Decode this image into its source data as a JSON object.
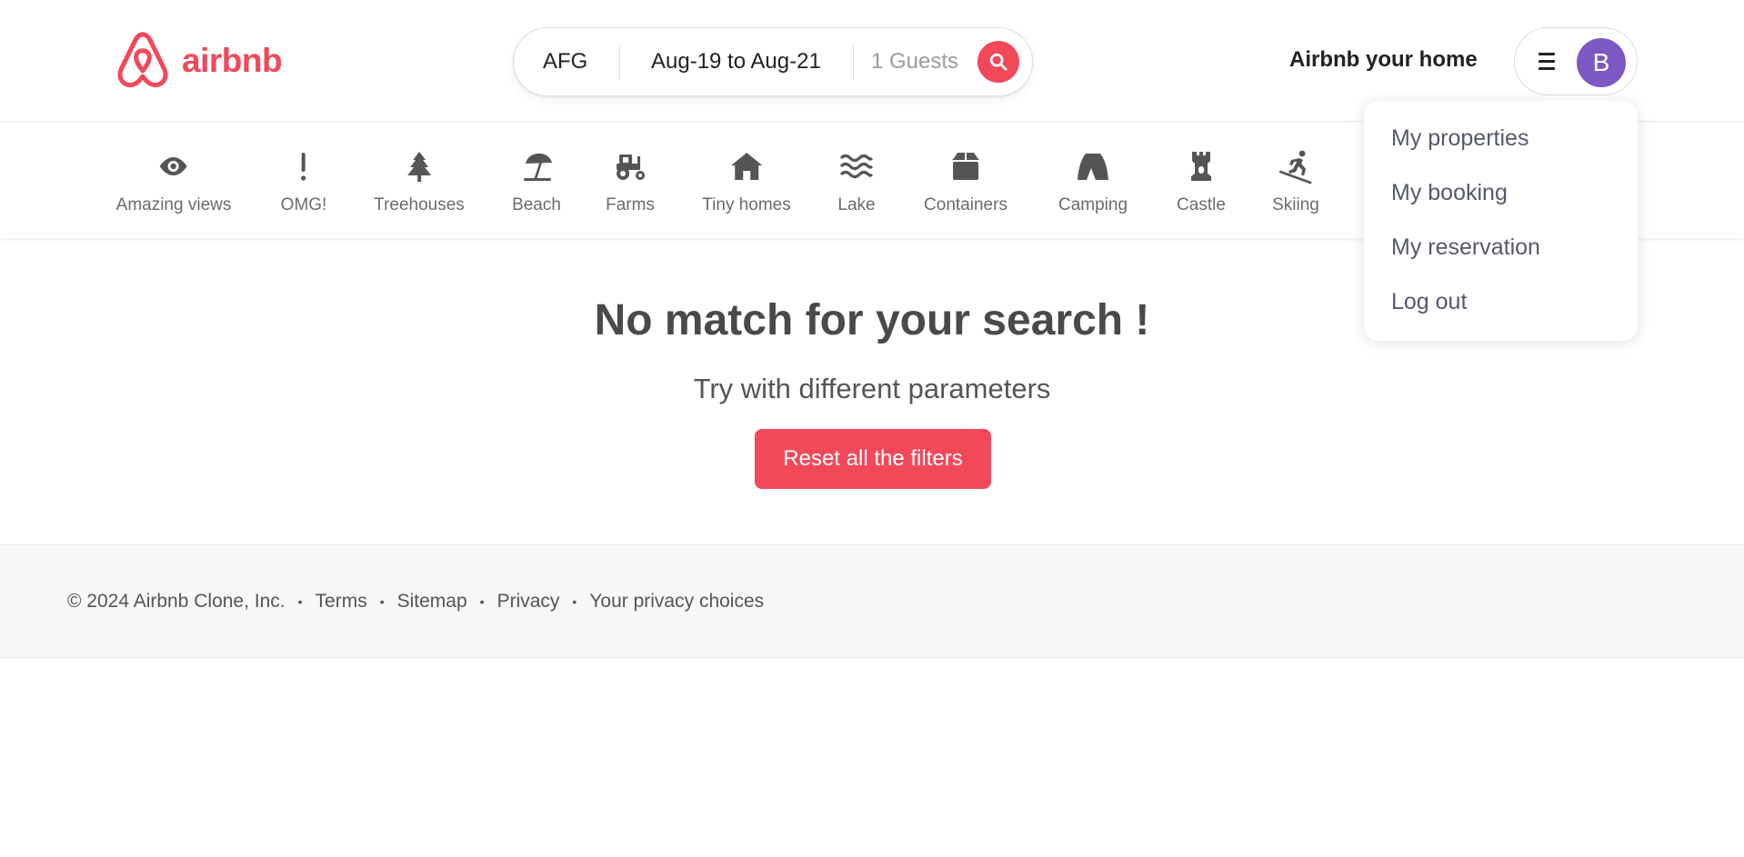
{
  "header": {
    "logo_text": "airbnb",
    "search": {
      "where": "AFG",
      "dates": "Aug-19 to Aug-21",
      "guests": "1 Guests"
    },
    "host_link": "Airbnb your home",
    "avatar_initial": "B"
  },
  "categories": [
    {
      "label": "Amazing views",
      "icon": "eye-icon"
    },
    {
      "label": "OMG!",
      "icon": "exclamation-icon"
    },
    {
      "label": "Treehouses",
      "icon": "tree-icon"
    },
    {
      "label": "Beach",
      "icon": "umbrella-beach-icon"
    },
    {
      "label": "Farms",
      "icon": "tractor-icon"
    },
    {
      "label": "Tiny homes",
      "icon": "house-icon"
    },
    {
      "label": "Lake",
      "icon": "water-icon"
    },
    {
      "label": "Containers",
      "icon": "box-icon"
    },
    {
      "label": "Camping",
      "icon": "tent-icon"
    },
    {
      "label": "Castle",
      "icon": "castle-icon"
    },
    {
      "label": "Skiing",
      "icon": "skier-icon"
    }
  ],
  "dropdown": {
    "items": [
      "My properties",
      "My booking",
      "My reservation",
      "Log out"
    ]
  },
  "main": {
    "title": "No match for your search !",
    "subtitle": "Try with different parameters",
    "reset_label": "Reset all the filters"
  },
  "footer": {
    "copyright": "© 2024 Airbnb Clone, Inc.",
    "links": [
      "Terms",
      "Sitemap",
      "Privacy",
      "Your privacy choices"
    ]
  },
  "colors": {
    "brand": "#f1485a",
    "avatar": "#7e58c2"
  }
}
